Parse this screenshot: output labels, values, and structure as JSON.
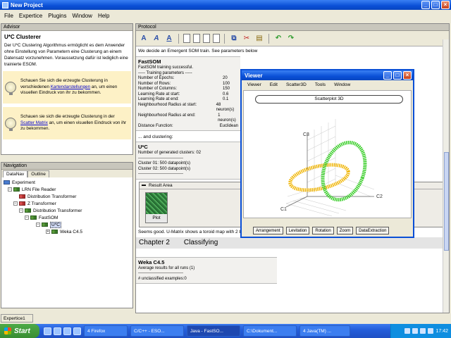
{
  "window": {
    "title": "New Project"
  },
  "menu": [
    "File",
    "Expertice",
    "Plugins",
    "Window",
    "Help"
  ],
  "advisor": {
    "header": "Advisor",
    "title": "U*C Clusterer",
    "text": "Der U*C Clustering Algorithmus ermöglicht es dem Anwender ohne Einstellung von Parametern eine Clusterung an einem Datensatz vorzunehmen. Voraussetzung dafür ist lediglich eine trainierte ESOM.",
    "tip1_pre": "Schauen Sie sich die erzeugte Clusterung in verschiedenen",
    "tip1_link": "Kartendarstellungen",
    "tip1_post": "an, um einen visuellen Eindruck von ihr zu bekommen.",
    "tip2_pre": "Schauen sie sich die erzeugte Clusterung in der",
    "tip2_link": "Scatter Matrix",
    "tip2_post": "an, um einen visuellen Eindruck von ihr zu bekommen."
  },
  "navigation": {
    "header": "Navigation",
    "tabs": [
      "DataNav",
      "Outline"
    ],
    "tree": {
      "root": "Experiment",
      "n1": "LRN File Reader",
      "n2": "Distribution Transformer",
      "n3": "Z Transformer",
      "n4": "Distribution Transformer",
      "n5": "FastSOM",
      "n6": "U*C",
      "n7": "Weka C4.5"
    }
  },
  "status_tab": "Expertice1",
  "protocol": {
    "header": "Protocol",
    "intro": "We decide an Emergent SOM train. See parameters below",
    "fastsom": {
      "title": "FastSOM",
      "line1": "FastSOM training successful.",
      "line2": "----- Training parameters -----",
      "params": [
        {
          "k": "Number of Epochs:",
          "v": "20"
        },
        {
          "k": "Number of Rows:",
          "v": "100"
        },
        {
          "k": "Number of Columns:",
          "v": "150"
        },
        {
          "k": "Learning Rate at start:",
          "v": "0.6"
        },
        {
          "k": "Learning Rate at end:",
          "v": "0.1"
        },
        {
          "k": "Neighbourhood Radius at start:",
          "v": "48 neuron(s)"
        },
        {
          "k": "Neighbourhood Radius at end:",
          "v": "1 neuron(s)"
        },
        {
          "k": "Distance Function:",
          "v": "Euclidean"
        }
      ]
    },
    "and_clustering": "... and clustering:",
    "uc": {
      "title": "U*C",
      "line1": "Number of generated clusters: 02",
      "line2": "--------------------------------",
      "line3": "Cluster 01: 500 datapoint(s)",
      "line4": "Cluster 02: 500 datapoint(s)",
      "line5": "--------------------------------"
    },
    "result_area": {
      "title": "Result Area",
      "plot_label": "Plot"
    },
    "conclusion": "Seems good. U-Matrix shows a toroid map with 2 bassins. U*C was able to find them.",
    "chapter": {
      "num": "Chapter 2",
      "title": "Classifying"
    },
    "weka": {
      "title": "Weka C4.5",
      "line1": "Average results for all runs (1)",
      "line2": "--------------------------------",
      "line3": "# unclassified examples:0"
    }
  },
  "viewer": {
    "title": "Viewer",
    "menu": [
      "Viewer",
      "Edit",
      "Scatter3D",
      "Tools",
      "Window"
    ],
    "plot_title": "Scatterplot 3D",
    "axes": {
      "c1": "C1",
      "c2": "C2",
      "c3": "C3"
    },
    "buttons": [
      "Arrangement",
      "Levitation",
      "Rotation",
      "Zoom",
      "DataExtraction"
    ],
    "colors": {
      "ring1": "#f0b400",
      "ring2": "#33cc22"
    }
  },
  "taskbar": {
    "start": "Start",
    "tasks": [
      "4 Firefox",
      "C/C++ - ESO...",
      "Java - FastSO...",
      "C:\\Dokument...",
      "4 Java(TM) ..."
    ],
    "clock": "17:42"
  }
}
